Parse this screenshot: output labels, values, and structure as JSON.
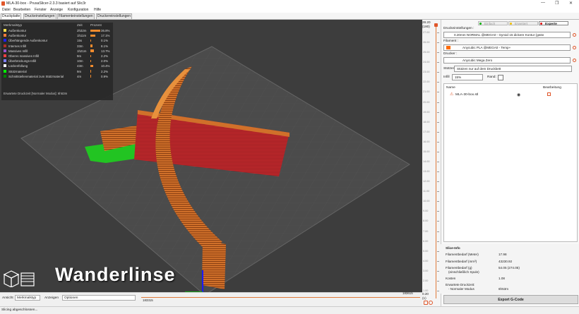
{
  "window": {
    "title": "MLA-30-box - PrusaSlicer-2.3.3 basiert auf Slic3r",
    "minimize": "—",
    "maximize": "❐",
    "close": "✕"
  },
  "menu": [
    "Datei",
    "Bearbeiten",
    "Fenster",
    "Anzeige",
    "Konfiguration",
    "Hilfe"
  ],
  "tabs": [
    "Druckplatte",
    "Druckeinstellungen",
    "Filamenteinstellungen",
    "Druckereinstellungen"
  ],
  "chart_data": {
    "type": "table",
    "headers": [
      "Merkmalstyp",
      "Zeit",
      "Prozent"
    ],
    "rows": [
      {
        "name": "Außenkontur",
        "time": "2h32m",
        "percent": "36.8%",
        "value": 36.8,
        "color": "#ffe14d"
      },
      {
        "name": "Außenkontur",
        "time": "1h11m",
        "percent": "17.1%",
        "value": 17.1,
        "color": "#ff7d38"
      },
      {
        "name": "Überhängende Außenkontur",
        "time": "15s",
        "percent": "0.1%",
        "value": 0.1,
        "color": "#1f1fff"
      },
      {
        "name": "Internes Infill",
        "time": "33m",
        "percent": "8.1%",
        "value": 8.1,
        "color": "#b03029"
      },
      {
        "name": "Massives Infill",
        "time": "1h21m",
        "percent": "13.7%",
        "value": 13.7,
        "color": "#9654cc"
      },
      {
        "name": "Oberes massives Infill",
        "time": "9m",
        "percent": "2.2%",
        "value": 2.2,
        "color": "#f04040"
      },
      {
        "name": "Überbrückungs-Infill",
        "time": "10m",
        "percent": "2.0%",
        "value": 2.0,
        "color": "#7f80ff"
      },
      {
        "name": "Lückenfüllung",
        "time": "43m",
        "percent": "10.4%",
        "value": 10.4,
        "color": "#ffffff"
      },
      {
        "name": "Stützmaterial",
        "time": "9m",
        "percent": "2.2%",
        "value": 2.2,
        "color": "#00ff00"
      },
      {
        "name": "Schnittstellenmaterial zum Stützmaterial",
        "time": "4m",
        "percent": "0.9%",
        "value": 0.9,
        "color": "#008000"
      }
    ],
    "estimate": "Erwartete Druckzeit [Normaler Modus]:  6h53m"
  },
  "overlay": {
    "brand": "Wanderlinse"
  },
  "bottom": {
    "view_label": "Ansicht",
    "view_value": "Merkmalstyp",
    "show_label": "Anzeigen",
    "show_value": "Optionen",
    "h_left": "183315",
    "h_right": "183615"
  },
  "vslider": {
    "top_value": "28.20",
    "top_sub": "(180)",
    "bottom_value": "0.20",
    "bottom_sub": "(1)",
    "ticks": [
      "27.00",
      "26.00",
      "25.00",
      "24.00",
      "23.00",
      "22.00",
      "21.00",
      "20.00",
      "19.00",
      "18.00",
      "17.00",
      "16.00",
      "15.00",
      "14.00",
      "13.00",
      "12.00",
      "11.00",
      "10.00",
      "9.00",
      "8.00",
      "7.00",
      "6.00",
      "5.00",
      "4.00",
      "3.00",
      "2.00",
      "1.00"
    ]
  },
  "rpanel": {
    "modes": [
      "Einfach",
      "Erweitert",
      "Experte"
    ],
    "mode_colors": [
      "#00b000",
      "#f0c000",
      "#e01010"
    ],
    "print_label": "Druckeinstellungen :",
    "print_value": "0.20mm NORMAL @MEGA0 - Gyroid 15 dickere Kontur (geän",
    "filament_label": "Filament :",
    "filament_value": "Anycubic PLA @MEGA0 - Temp+",
    "printer_label": "Drucker :",
    "printer_value": "Anycubic Mega Zero",
    "support_label": "Stützen",
    "support_value": "Stützen nur auf dem Druckbett",
    "infill_label": "Infill",
    "infill_value": "15%",
    "brim_label": "Rand:",
    "obj_col_name": "Name",
    "obj_col_edit": "Bearbeitung",
    "obj_name": "MLA-30-box.stl"
  },
  "sliceinfo": {
    "title": "Slice-Info",
    "rows": [
      {
        "k": "Filamentbedarf (Meter)",
        "v": "17.98"
      },
      {
        "k": "Filamentbedarf (mm³)",
        "v": "43230.92"
      },
      {
        "k": "Filamentbedarf (g)",
        "k2": "(einschließlich Spule)",
        "v": "54.05 (274.05)"
      },
      {
        "k": "Kosten",
        "v": "1.08"
      },
      {
        "k": "Erwartete Druckzeit:",
        "k2": "- Normaler Modus",
        "v": "6h53m"
      }
    ]
  },
  "export": "Export G-Code",
  "status": "Slicing abgeschlossen..."
}
